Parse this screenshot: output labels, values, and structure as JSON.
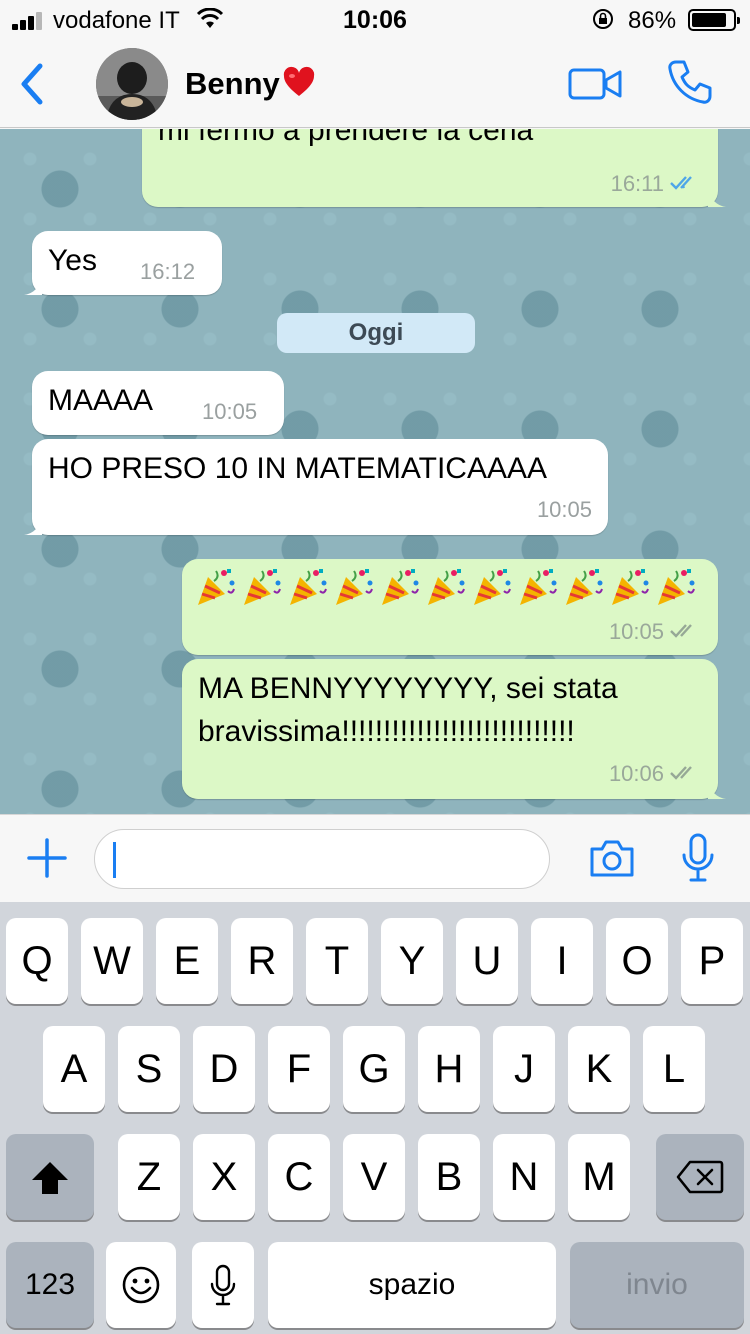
{
  "status_bar": {
    "carrier": "vodafone IT",
    "time": "10:06",
    "battery_percent": "86%",
    "battery_level": 0.86
  },
  "header": {
    "back_icon": "chevron-left-icon",
    "contact_name": "Benny",
    "contact_emoji": "heart-icon",
    "video_icon": "video-camera-icon",
    "call_icon": "phone-icon"
  },
  "chat": {
    "messages": [
      {
        "direction": "out",
        "text": "mi fermo a prendere la cena",
        "time": "16:11",
        "status": "read"
      },
      {
        "direction": "in",
        "text": "Yes",
        "time": "16:12"
      },
      {
        "direction": "in",
        "text": "MAAAA",
        "time": "10:05"
      },
      {
        "direction": "in",
        "text": "HO PRESO 10 IN MATEMATICAAAA",
        "time": "10:05"
      },
      {
        "direction": "out",
        "emoji_count": 11,
        "emoji": "party-popper-icon",
        "time": "10:05",
        "status": "delivered"
      },
      {
        "direction": "out",
        "text_line1": "MA BENNYYYYYYYY, sei stata",
        "text_line2": "bravissima!!!!!!!!!!!!!!!!!!!!!!!!!!!!",
        "time": "10:06",
        "status": "delivered"
      }
    ],
    "date_separator": "Oggi"
  },
  "input_bar": {
    "plus_icon": "plus-icon",
    "text_value": "",
    "camera_icon": "camera-icon",
    "mic_icon": "microphone-icon"
  },
  "keyboard": {
    "row1": [
      "Q",
      "W",
      "E",
      "R",
      "T",
      "Y",
      "U",
      "I",
      "O",
      "P"
    ],
    "row2": [
      "A",
      "S",
      "D",
      "F",
      "G",
      "H",
      "J",
      "K",
      "L"
    ],
    "row3": [
      "Z",
      "X",
      "C",
      "V",
      "B",
      "N",
      "M"
    ],
    "numbers_label": "123",
    "space_label": "spazio",
    "send_label": "invio"
  },
  "colors": {
    "accent": "#1a7ef2",
    "outgoing_bubble": "#dcf8c6",
    "incoming_bubble": "#ffffff",
    "read_ticks": "#4fa6e8"
  }
}
